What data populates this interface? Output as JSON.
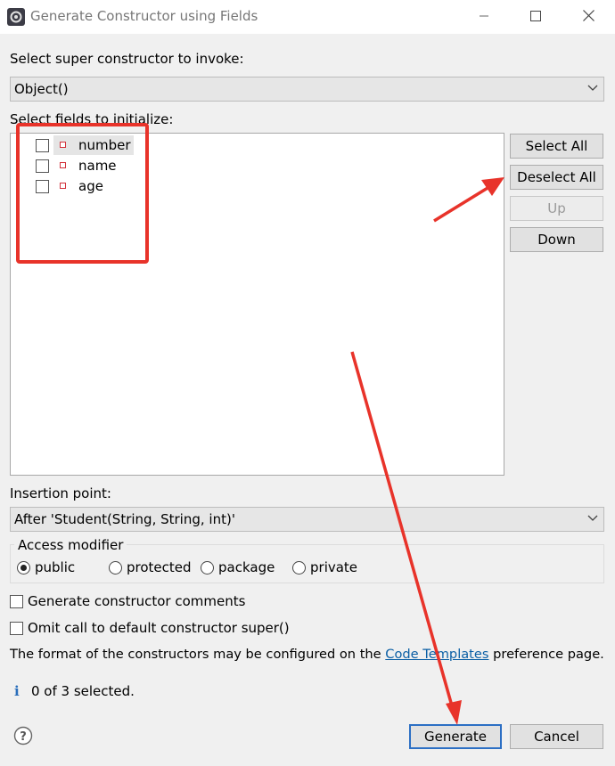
{
  "window": {
    "title": "Generate Constructor using Fields",
    "controls": [
      "minimize-icon",
      "maximize-icon",
      "close-icon"
    ]
  },
  "super_constructor": {
    "label": "Select super constructor to invoke:",
    "selected": "Object()"
  },
  "fields": {
    "label": "Select fields to initialize:",
    "items": [
      {
        "name": "number",
        "checked": false,
        "highlighted": true
      },
      {
        "name": "name",
        "checked": false,
        "highlighted": false
      },
      {
        "name": "age",
        "checked": false,
        "highlighted": false
      }
    ],
    "buttons": {
      "select_all": "Select All",
      "deselect_all": "Deselect All",
      "up": "Up",
      "down": "Down"
    }
  },
  "insertion_point": {
    "label": "Insertion point:",
    "selected": "After 'Student(String, String, int)'"
  },
  "access_modifier": {
    "label": "Access modifier",
    "options": [
      "public",
      "protected",
      "package",
      "private"
    ],
    "selected": "public"
  },
  "options": {
    "generate_comments": {
      "label": "Generate constructor comments",
      "checked": false
    },
    "omit_super": {
      "label": "Omit call to default constructor super()",
      "checked": false
    }
  },
  "info_text": {
    "before": "The format of the constructors may be configured on the ",
    "link": "Code Templates",
    "after": " preference page."
  },
  "status": {
    "icon": "info-icon",
    "text": "0 of 3 selected."
  },
  "footer": {
    "help_icon": "help-icon",
    "generate": "Generate",
    "cancel": "Cancel"
  },
  "annotation_colors": {
    "highlight": "#e8332a"
  }
}
